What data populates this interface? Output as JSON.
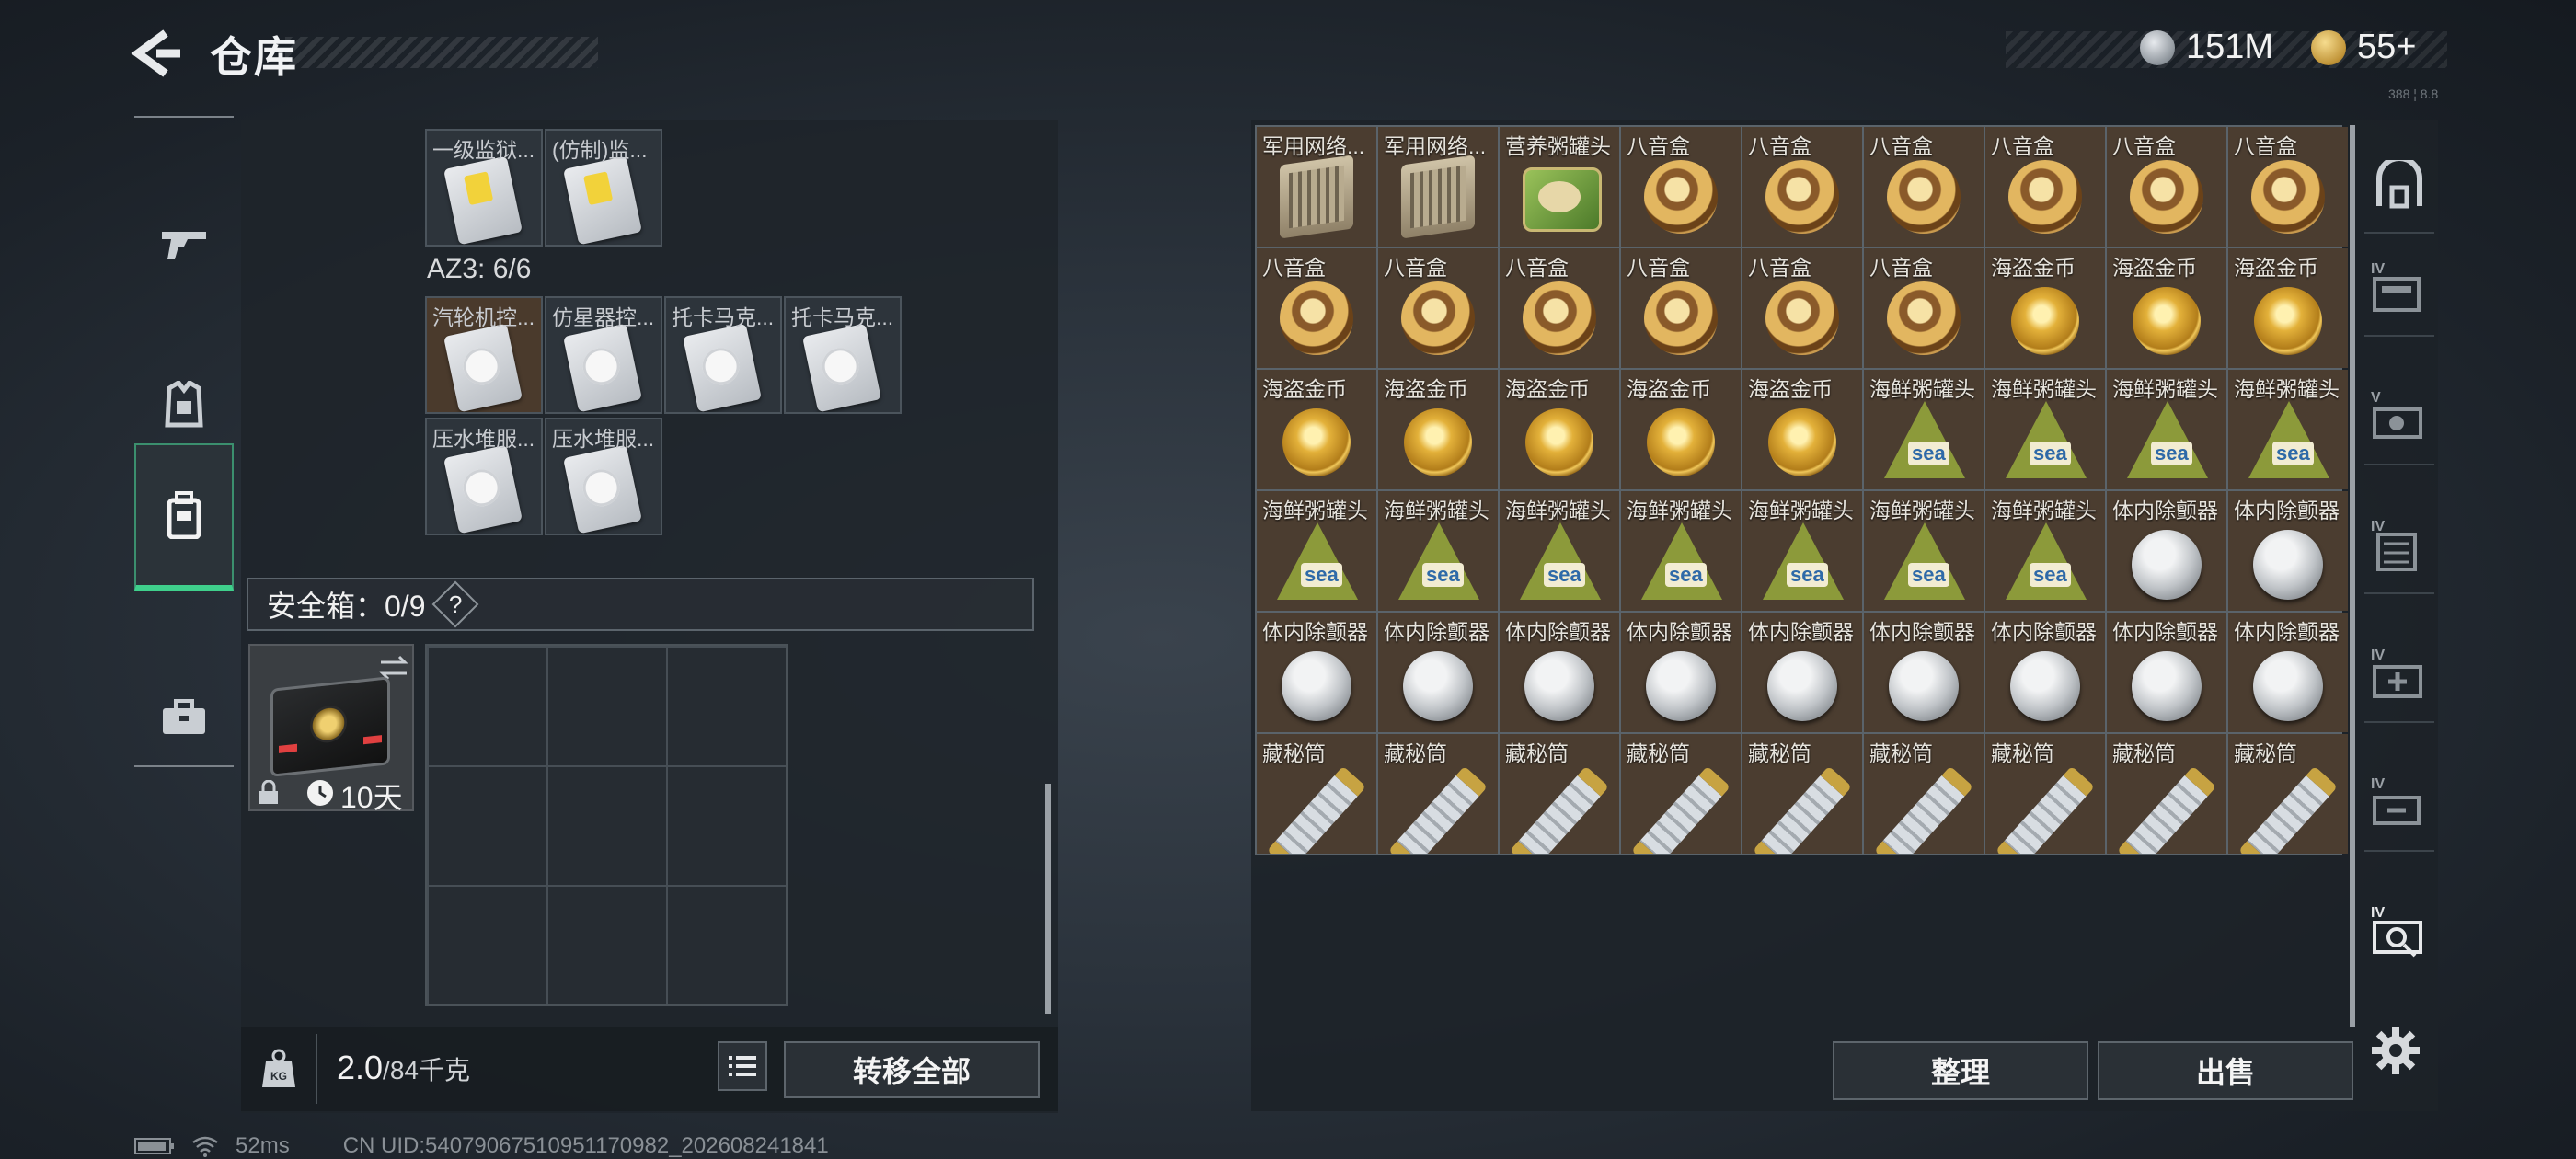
{
  "header": {
    "title": "仓库",
    "currency_silver": "151M",
    "currency_gold": "55+",
    "tiny_label": "388 ¦ 8.8"
  },
  "left": {
    "top_items": [
      {
        "label": "一级监狱..."
      },
      {
        "label": "(仿制)监..."
      }
    ],
    "az3_label": "AZ3: 6/6",
    "az3_items": [
      {
        "label": "汽轮机控..."
      },
      {
        "label": "仿星器控..."
      },
      {
        "label": "托卡马克..."
      },
      {
        "label": "托卡马克..."
      },
      {
        "label": "压水堆服..."
      },
      {
        "label": "压水堆服..."
      }
    ],
    "safe_label": "安全箱：0/9",
    "safe_help": "?",
    "safebox_days": "10天",
    "weight_current": "2.0",
    "weight_max": "/84千克",
    "transfer_all": "转移全部"
  },
  "grid": [
    {
      "label": "军用网络...",
      "type": "router"
    },
    {
      "label": "军用网络...",
      "type": "router"
    },
    {
      "label": "营养粥罐头",
      "type": "tin"
    },
    {
      "label": "八音盒",
      "type": "music"
    },
    {
      "label": "八音盒",
      "type": "music"
    },
    {
      "label": "八音盒",
      "type": "music"
    },
    {
      "label": "八音盒",
      "type": "music"
    },
    {
      "label": "八音盒",
      "type": "music"
    },
    {
      "label": "八音盒",
      "type": "music"
    },
    {
      "label": "八音盒",
      "type": "music"
    },
    {
      "label": "八音盒",
      "type": "music"
    },
    {
      "label": "八音盒",
      "type": "music"
    },
    {
      "label": "八音盒",
      "type": "music"
    },
    {
      "label": "八音盒",
      "type": "music"
    },
    {
      "label": "八音盒",
      "type": "music"
    },
    {
      "label": "海盗金币",
      "type": "coinpirate"
    },
    {
      "label": "海盗金币",
      "type": "coinpirate"
    },
    {
      "label": "海盗金币",
      "type": "coinpirate"
    },
    {
      "label": "海盗金币",
      "type": "coinpirate"
    },
    {
      "label": "海盗金币",
      "type": "coinpirate"
    },
    {
      "label": "海盗金币",
      "type": "coinpirate"
    },
    {
      "label": "海盗金币",
      "type": "coinpirate"
    },
    {
      "label": "海盗金币",
      "type": "coinpirate"
    },
    {
      "label": "海鲜粥罐头",
      "type": "seafood"
    },
    {
      "label": "海鲜粥罐头",
      "type": "seafood"
    },
    {
      "label": "海鲜粥罐头",
      "type": "seafood"
    },
    {
      "label": "海鲜粥罐头",
      "type": "seafood"
    },
    {
      "label": "海鲜粥罐头",
      "type": "seafood"
    },
    {
      "label": "海鲜粥罐头",
      "type": "seafood"
    },
    {
      "label": "海鲜粥罐头",
      "type": "seafood"
    },
    {
      "label": "海鲜粥罐头",
      "type": "seafood"
    },
    {
      "label": "海鲜粥罐头",
      "type": "seafood"
    },
    {
      "label": "海鲜粥罐头",
      "type": "seafood"
    },
    {
      "label": "海鲜粥罐头",
      "type": "seafood"
    },
    {
      "label": "体内除颤器",
      "type": "implant"
    },
    {
      "label": "体内除颤器",
      "type": "implant"
    },
    {
      "label": "体内除颤器",
      "type": "implant"
    },
    {
      "label": "体内除颤器",
      "type": "implant"
    },
    {
      "label": "体内除颤器",
      "type": "implant"
    },
    {
      "label": "体内除颤器",
      "type": "implant"
    },
    {
      "label": "体内除颤器",
      "type": "implant"
    },
    {
      "label": "体内除颤器",
      "type": "implant"
    },
    {
      "label": "体内除颤器",
      "type": "implant"
    },
    {
      "label": "体内除颤器",
      "type": "implant"
    },
    {
      "label": "体内除颤器",
      "type": "implant"
    },
    {
      "label": "藏秘筒",
      "type": "cryptex"
    },
    {
      "label": "藏秘筒",
      "type": "cryptex"
    },
    {
      "label": "藏秘筒",
      "type": "cryptex"
    },
    {
      "label": "藏秘筒",
      "type": "cryptex"
    },
    {
      "label": "藏秘筒",
      "type": "cryptex"
    },
    {
      "label": "藏秘筒",
      "type": "cryptex"
    },
    {
      "label": "藏秘筒",
      "type": "cryptex"
    },
    {
      "label": "藏秘筒",
      "type": "cryptex"
    },
    {
      "label": "藏秘筒",
      "type": "cryptex"
    }
  ],
  "right_buttons": {
    "sort": "整理",
    "sell": "出售"
  },
  "right_sidebar": [
    {
      "tag": ""
    },
    {
      "tag": "IV"
    },
    {
      "tag": "V"
    },
    {
      "tag": "IV"
    },
    {
      "tag": "IV"
    },
    {
      "tag": "IV"
    },
    {
      "tag": "IV"
    }
  ],
  "status": {
    "ping": "52ms",
    "uid": "CN UID:5407906751095117098​2_202608241841"
  },
  "colors": {
    "accent_green": "#3fd08c",
    "cell_brown": "#4b3d30"
  }
}
